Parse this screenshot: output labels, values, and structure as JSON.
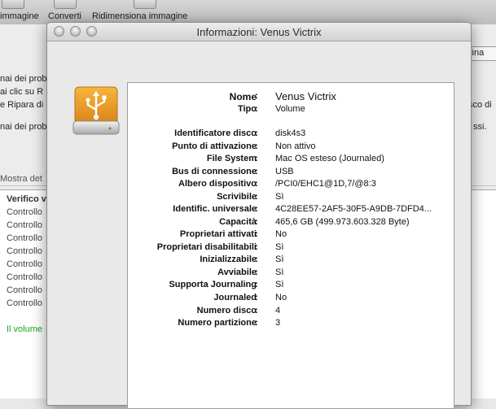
{
  "toolbar": {
    "items": [
      {
        "label": "immagine"
      },
      {
        "label": "Converti"
      },
      {
        "label": "Ridimensiona immagine"
      }
    ]
  },
  "background": {
    "tab_label": "stina",
    "lines": [
      {
        "text": "nai dei prob"
      },
      {
        "text": "ai clic su R"
      },
      {
        "text": "e Ripara di"
      },
      {
        "text": "nai dei prob"
      }
    ],
    "right_fragments": [
      "sco di",
      "ssi."
    ],
    "show_details": "Mostra det",
    "log": [
      {
        "text": "Verifico v",
        "style": "bold"
      },
      {
        "text": "Controllo"
      },
      {
        "text": "Controllo"
      },
      {
        "text": "Controllo"
      },
      {
        "text": "Controllo"
      },
      {
        "text": "Controllo"
      },
      {
        "text": "Controllo"
      },
      {
        "text": "Controllo"
      },
      {
        "text": "Controllo"
      },
      {
        "text": "Il volume",
        "style": "green"
      }
    ]
  },
  "window": {
    "title": "Informazioni: Venus Victrix",
    "icon": "external-drive-usb-icon",
    "accent_color": "#f0a020",
    "fields": [
      {
        "label": "Nome",
        "value": "Venus Victrix",
        "big": true
      },
      {
        "label": "Tipo",
        "value": "Volume"
      },
      {
        "label": "Identificatore disco",
        "value": "disk4s3"
      },
      {
        "label": "Punto di attivazione",
        "value": "Non attivo"
      },
      {
        "label": "File System",
        "value": "Mac OS esteso (Journaled)"
      },
      {
        "label": "Bus di connessione",
        "value": "USB"
      },
      {
        "label": "Albero dispositivo",
        "value": "/PCI0/EHC1@1D,7/@8:3"
      },
      {
        "label": "Scrivibile",
        "value": "Sì"
      },
      {
        "label": "Identific. universale",
        "value": "4C28EE57-2AF5-30F5-A9DB-7DFD4..."
      },
      {
        "label": "Capacità",
        "value": "465,6 GB (499.973.603.328 Byte)"
      },
      {
        "label": "Proprietari attivati",
        "value": "No"
      },
      {
        "label": "Proprietari disabilitabili",
        "value": "Sì"
      },
      {
        "label": "Inizializzabile",
        "value": "Sì"
      },
      {
        "label": "Avviabile",
        "value": "Sì"
      },
      {
        "label": "Supporta Journaling",
        "value": "Sì"
      },
      {
        "label": "Journaled",
        "value": "No"
      },
      {
        "label": "Numero disco",
        "value": "4"
      },
      {
        "label": "Numero partizione",
        "value": "3"
      }
    ]
  }
}
